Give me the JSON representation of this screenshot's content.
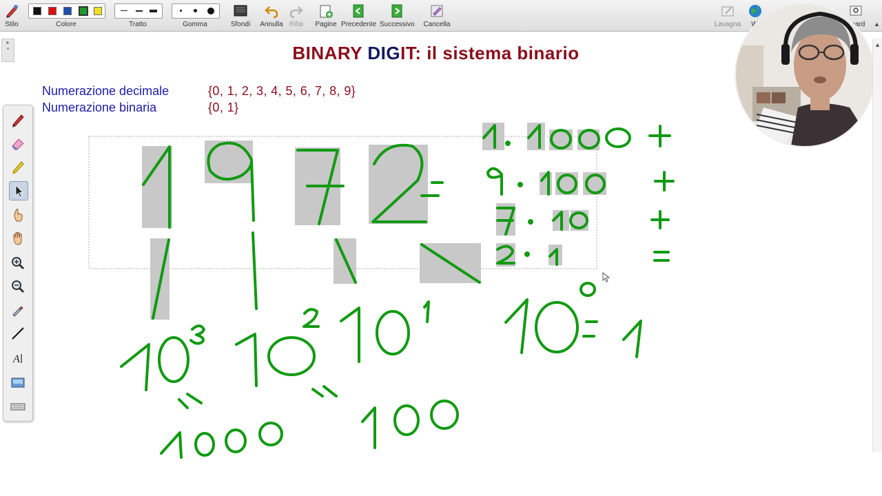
{
  "toolbar": {
    "stilo": "Stilo",
    "colore": "Colore",
    "tratto": "Tratto",
    "gomma": "Gomma",
    "sfondi": "Sfondi",
    "annulla": "Annulla",
    "rifai": "Rifai",
    "pagine": "Pagine",
    "precedente": "Precedente",
    "successivo": "Successivo",
    "cancella": "Cancella",
    "lavagna": "Lavagna",
    "web_partial": "W",
    "board_partial": "Board",
    "colors": [
      "#111111",
      "#e01010",
      "#1a4fb0",
      "#1e9a2a",
      "#f0e020"
    ]
  },
  "page": {
    "title_part1": "BINARY",
    "title_part2": " DIG",
    "title_part3": "IT",
    "title_part4": ": il sistema binario",
    "decimal_label": "Numerazione decimale",
    "decimal_set": "{0, 1, 2, 3, 4, 5, 6, 7, 8, 9}",
    "binary_label": "Numerazione binaria",
    "binary_set": "{0, 1}"
  },
  "handwriting": {
    "number": "1972",
    "ink_color": "#119a11",
    "expansion": [
      {
        "digit": "1",
        "factor": "1000",
        "op": "+"
      },
      {
        "digit": "9",
        "factor": "100",
        "op": "+"
      },
      {
        "digit": "7",
        "factor": "10",
        "op": "+"
      },
      {
        "digit": "2",
        "factor": "1",
        "op": "="
      }
    ],
    "powers": [
      {
        "base": "10",
        "exp": "3"
      },
      {
        "base": "10",
        "exp": "2"
      },
      {
        "base": "10",
        "exp": "1"
      },
      {
        "base": "10",
        "exp": "0",
        "result": "1"
      }
    ],
    "values": [
      "1000",
      "100"
    ]
  },
  "icons": [
    "pen-icon",
    "eraser-icon",
    "highlighter-icon",
    "pointer-icon",
    "hand-pointer-icon",
    "hand-icon",
    "zoom-in-icon",
    "zoom-out-icon",
    "dropper-icon",
    "line-icon",
    "text-icon",
    "screen-capture-icon",
    "keyboard-icon"
  ]
}
